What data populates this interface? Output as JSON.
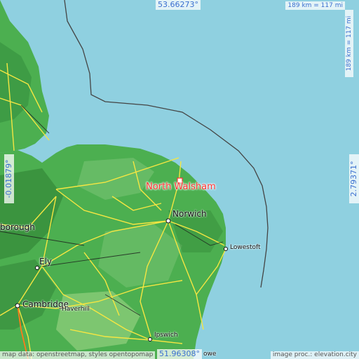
{
  "map": {
    "coords": {
      "north": "53.66273°",
      "south": "51.96308°",
      "west": "-0.01879°",
      "east": "2.79371°"
    },
    "scale": {
      "top": "189 km = 117 mi",
      "right": "189 km = 117 mi"
    },
    "focus_place": {
      "name": "North Walsham",
      "marker_color": "#ff3333"
    },
    "cities": [
      {
        "key": "norwich",
        "name": "Norwich"
      },
      {
        "key": "lowestoft",
        "name": "Lowestoft"
      },
      {
        "key": "ely",
        "name": "Ely"
      },
      {
        "key": "cambridge",
        "name": "Cambridge"
      },
      {
        "key": "peterborough",
        "name": "borough"
      },
      {
        "key": "haverhill",
        "name": "Haverhill"
      },
      {
        "key": "ipswich",
        "name": "Ipswich"
      },
      {
        "key": "felixstowe",
        "name": "owe"
      }
    ],
    "attribution": {
      "left": "map data: openstreetmap, styles opentopomap",
      "right": "image proc.: elevation.city"
    },
    "colors": {
      "sea": "#8fd0e0",
      "land": "#4caf50",
      "roads": "#f5e642",
      "focus": "#ff3333"
    }
  }
}
